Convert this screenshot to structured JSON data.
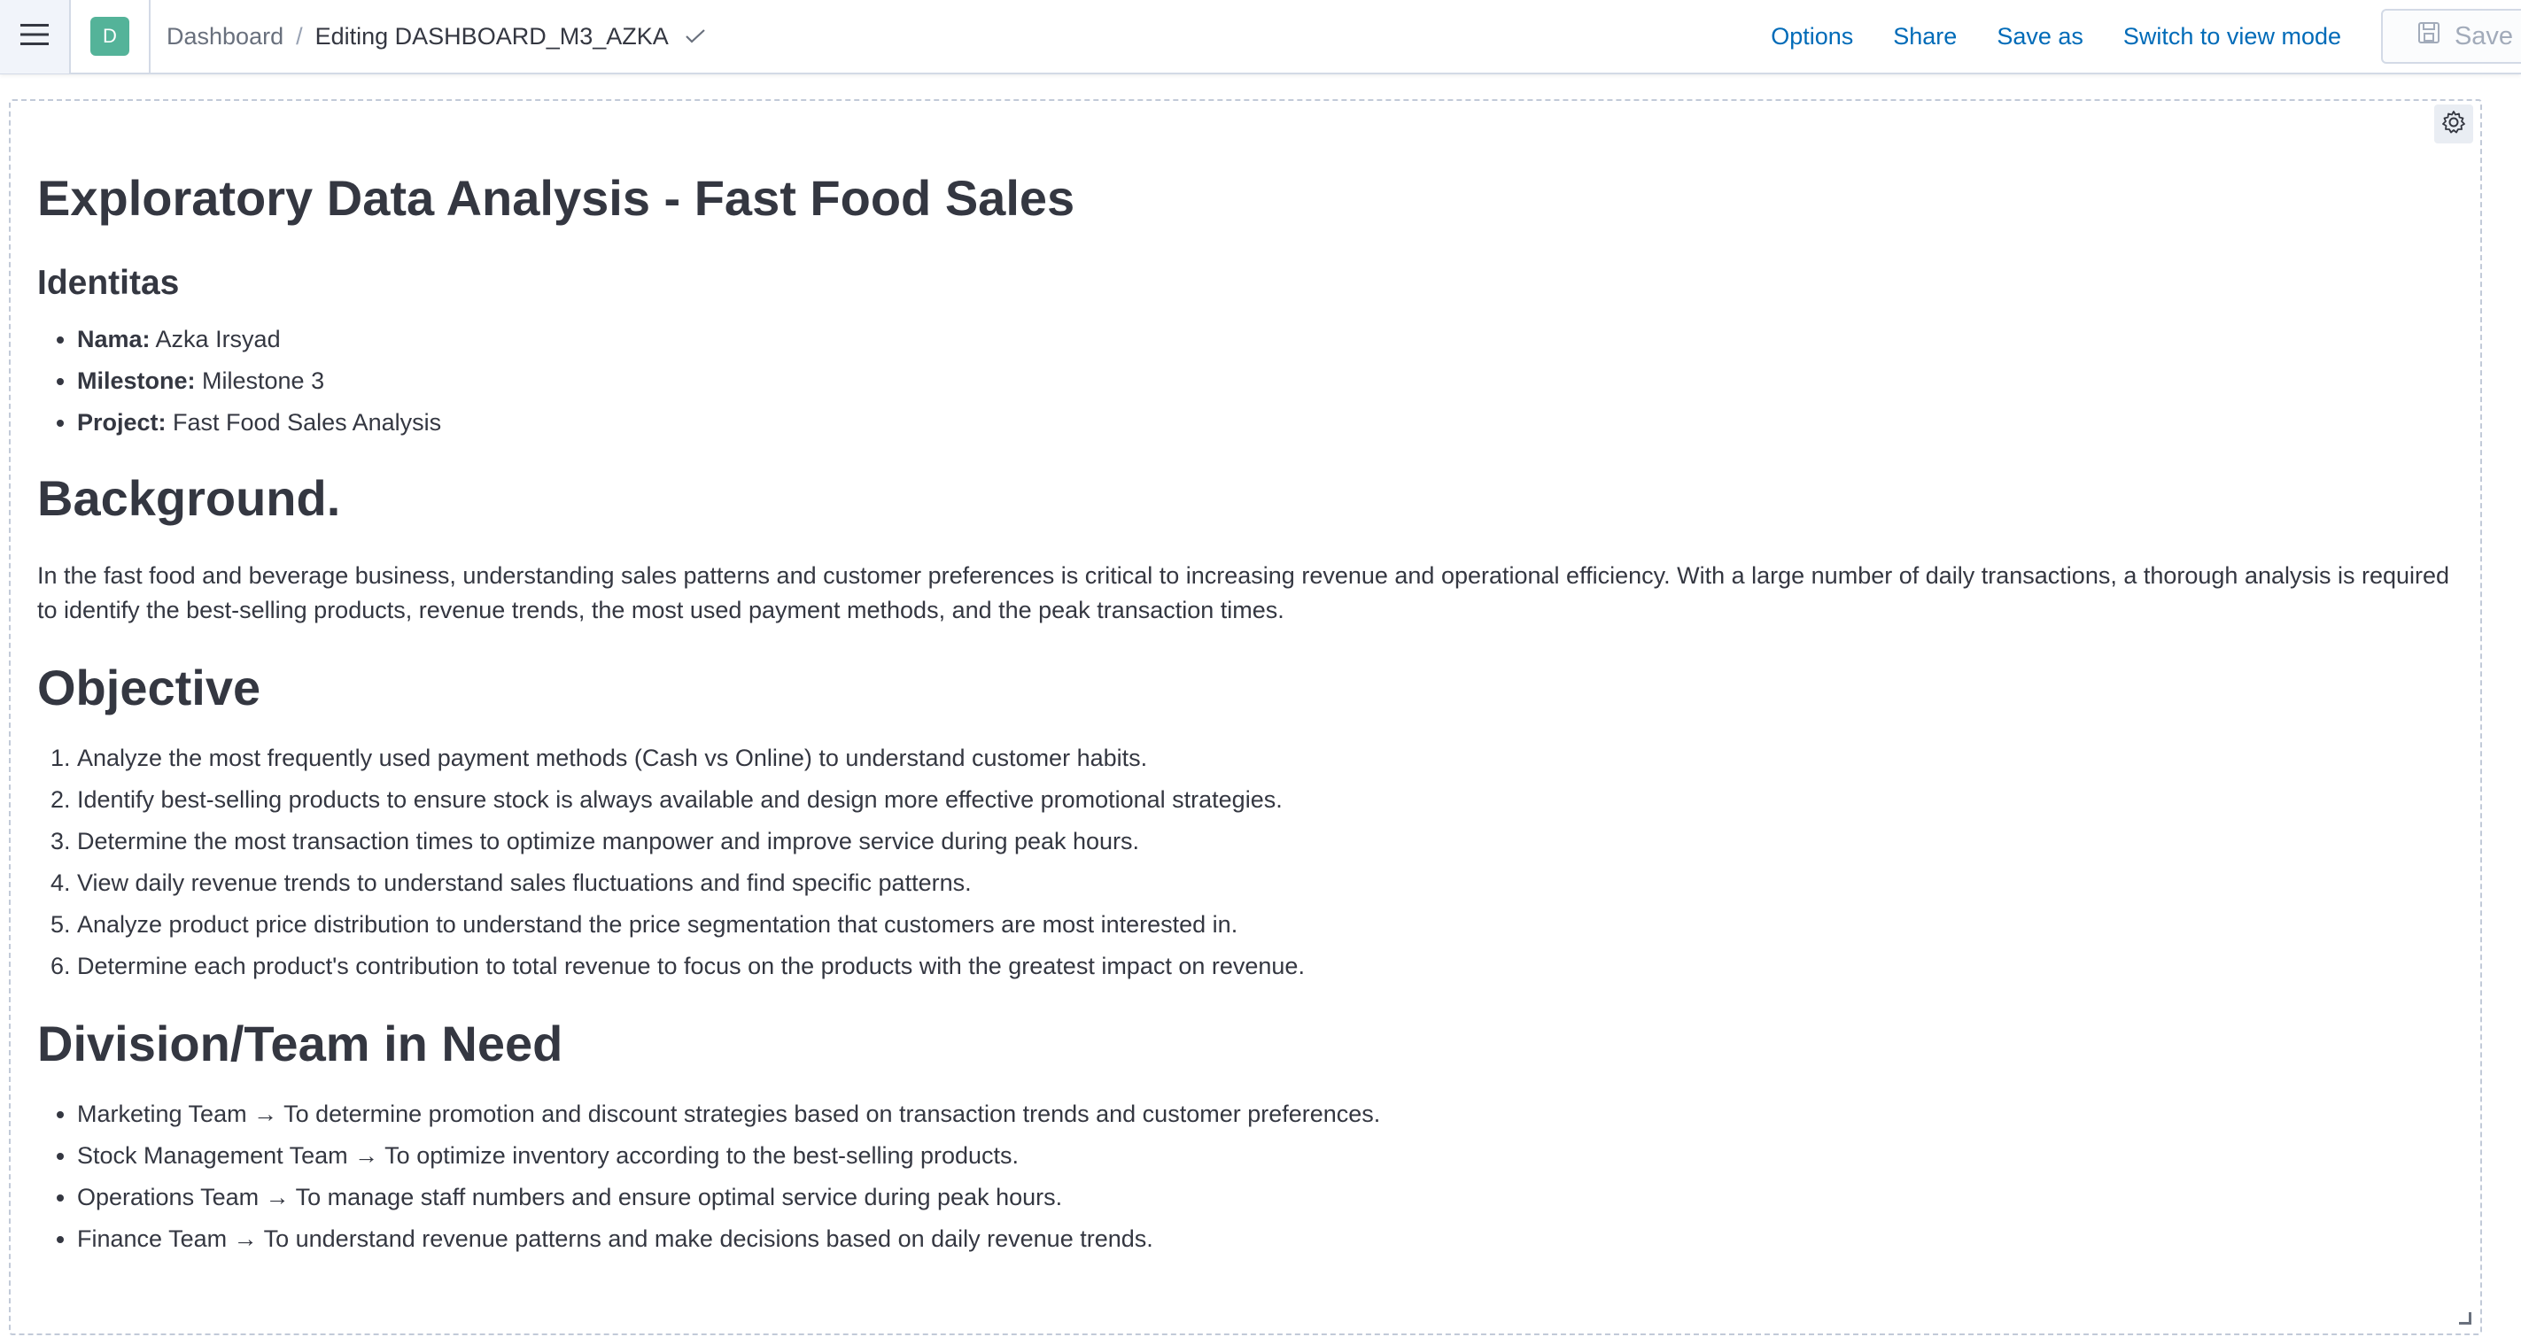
{
  "header": {
    "space_initial": "D",
    "breadcrumb_root": "Dashboard",
    "breadcrumb_separator": "/",
    "breadcrumb_current": "Editing DASHBOARD_M3_AZKA",
    "options_label": "Options",
    "share_label": "Share",
    "save_as_label": "Save as",
    "switch_mode_label": "Switch to view mode",
    "save_label": "Save"
  },
  "panel": {
    "title": "Exploratory Data Analysis - Fast Food Sales",
    "identity_heading": "Identitas",
    "identity_items": [
      {
        "label": "Nama:",
        "value": " Azka Irsyad"
      },
      {
        "label": "Milestone:",
        "value": " Milestone 3"
      },
      {
        "label": "Project:",
        "value": " Fast Food Sales Analysis"
      }
    ],
    "background_heading": "Background.",
    "background_text": "In the fast food and beverage business, understanding sales patterns and customer preferences is critical to increasing revenue and operational efficiency. With a large number of daily transactions, a thorough analysis is required to identify the best-selling products, revenue trends, the most used payment methods, and the peak transaction times.",
    "objective_heading": "Objective",
    "objectives": [
      "Analyze the most frequently used payment methods (Cash vs Online) to understand customer habits.",
      "Identify best-selling products to ensure stock is always available and design more effective promotional strategies.",
      "Determine the most transaction times to optimize manpower and improve service during peak hours.",
      "View daily revenue trends to understand sales fluctuations and find specific patterns.",
      "Analyze product price distribution to understand the price segmentation that customers are most interested in.",
      "Determine each product's contribution to total revenue to focus on the products with the greatest impact on revenue."
    ],
    "division_heading": "Division/Team in Need",
    "divisions": [
      "Marketing Team → To determine promotion and discount strategies based on transaction trends and customer preferences.",
      "Stock Management Team → To optimize inventory according to the best-selling products.",
      "Operations Team → To manage staff numbers and ensure optimal service during peak hours.",
      "Finance Team → To understand revenue patterns and make decisions based on daily revenue trends."
    ]
  }
}
